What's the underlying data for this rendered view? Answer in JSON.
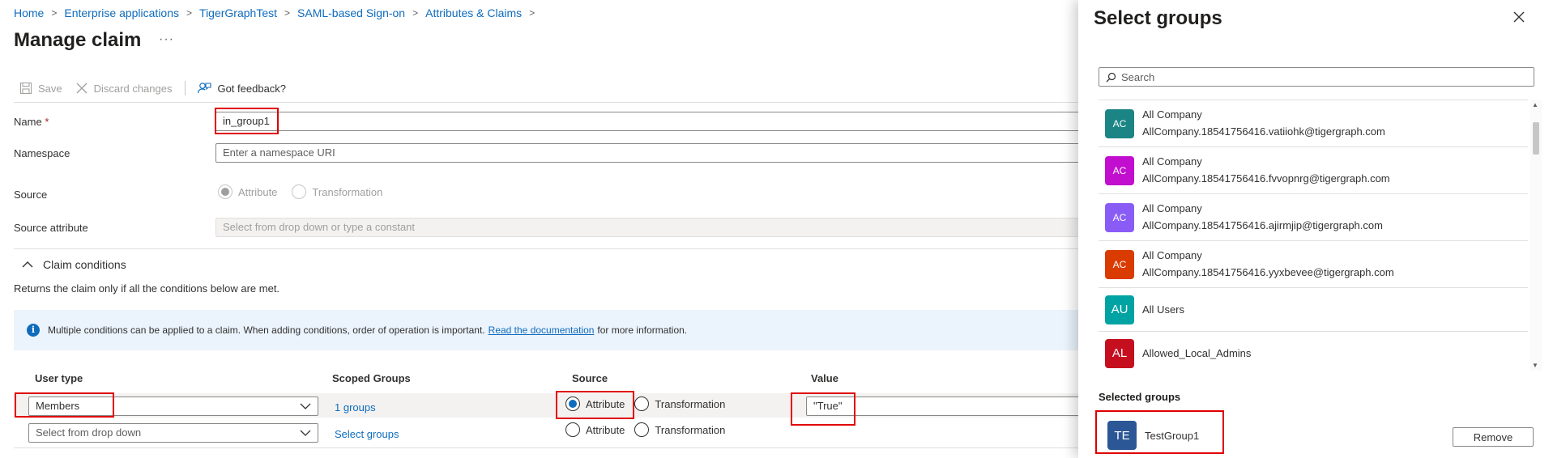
{
  "breadcrumb": [
    "Home",
    "Enterprise applications",
    "TigerGraphTest",
    "SAML-based Sign-on",
    "Attributes & Claims"
  ],
  "page": {
    "title": "Manage claim",
    "more": "···"
  },
  "toolbar": {
    "save": "Save",
    "discard": "Discard changes",
    "feedback": "Got feedback?"
  },
  "form": {
    "name_label": "Name",
    "required_mark": "*",
    "name_value": "in_group1",
    "namespace_label": "Namespace",
    "namespace_placeholder": "Enter a namespace URI",
    "source_label": "Source",
    "source_options": [
      "Attribute",
      "Transformation"
    ],
    "source_attribute_label": "Source attribute",
    "source_attribute_placeholder": "Select from drop down or type a constant"
  },
  "conditions": {
    "title": "Claim conditions",
    "description": "Returns the claim only if all the conditions below are met.",
    "info_text": "Multiple conditions can be applied to a claim.  When adding conditions, order of operation is important.",
    "info_link": "Read the documentation",
    "info_suffix": "for more information.",
    "columns": [
      "User type",
      "Scoped Groups",
      "Source",
      "Value"
    ],
    "rows": [
      {
        "user_type": "Members",
        "scoped": "1 groups",
        "source_selected": "Attribute",
        "value": "\"True\""
      },
      {
        "user_type": "Select from drop down",
        "scoped": "Select groups",
        "source_selected": "",
        "value": ""
      }
    ],
    "source_options": [
      "Attribute",
      "Transformation"
    ]
  },
  "panel": {
    "title": "Select groups",
    "search_placeholder": "Search",
    "groups": [
      {
        "initials": "AC",
        "name": "All Company",
        "email": "AllCompany.18541756416.vatiiohk@tigergraph.com",
        "color": "#1b8585"
      },
      {
        "initials": "AC",
        "name": "All Company",
        "email": "AllCompany.18541756416.fvvopnrg@tigergraph.com",
        "color": "#c20fcf"
      },
      {
        "initials": "AC",
        "name": "All Company",
        "email": "AllCompany.18541756416.ajirmjip@tigergraph.com",
        "color": "#8a5cf6"
      },
      {
        "initials": "AC",
        "name": "All Company",
        "email": "AllCompany.18541756416.yyxbevee@tigergraph.com",
        "color": "#da3b01"
      },
      {
        "initials": "AU",
        "name": "All Users",
        "email": "",
        "color": "#00a3a3"
      },
      {
        "initials": "AL",
        "name": "Allowed_Local_Admins",
        "email": "",
        "color": "#c50f1f"
      }
    ],
    "selected_title": "Selected groups",
    "selected": {
      "initials": "TE",
      "name": "TestGroup1",
      "color": "#2b5796"
    },
    "remove": "Remove"
  }
}
